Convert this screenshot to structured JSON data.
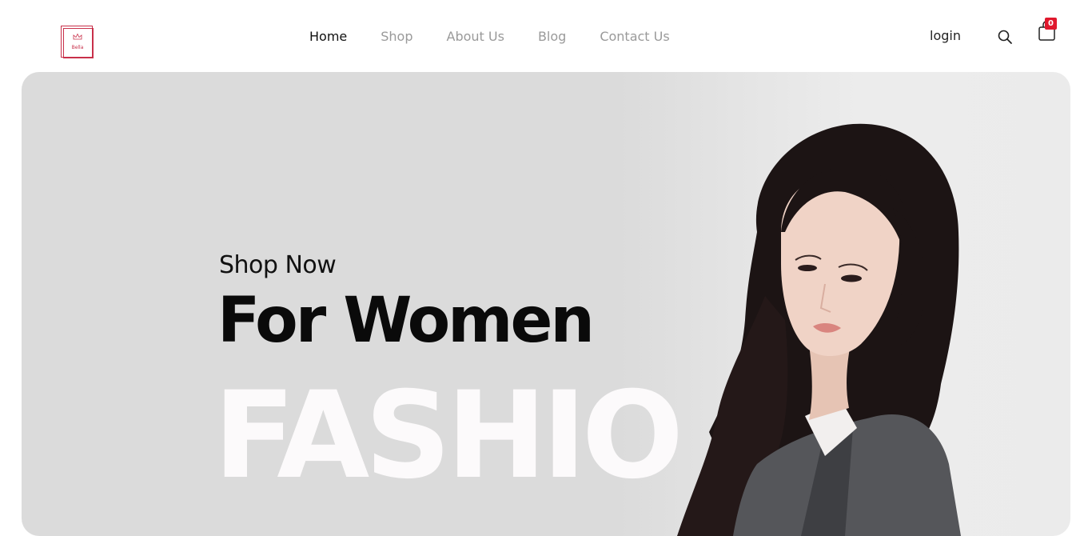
{
  "brand": {
    "logo_text": "Bella",
    "accent_color": "#c8304a"
  },
  "nav": {
    "items": [
      {
        "label": "Home",
        "active": true
      },
      {
        "label": "Shop",
        "active": false
      },
      {
        "label": "About Us",
        "active": false
      },
      {
        "label": "Blog",
        "active": false
      },
      {
        "label": "Contact Us",
        "active": false
      }
    ]
  },
  "header": {
    "login_label": "login",
    "search_icon": "search-icon",
    "cart_icon": "shopping-bag-icon",
    "cart_count": "0",
    "badge_color": "#e0182d"
  },
  "hero": {
    "kicker": "Shop Now",
    "headline": "For Women",
    "background_word": "FASHIO",
    "background_color": "#dbdbdb"
  }
}
